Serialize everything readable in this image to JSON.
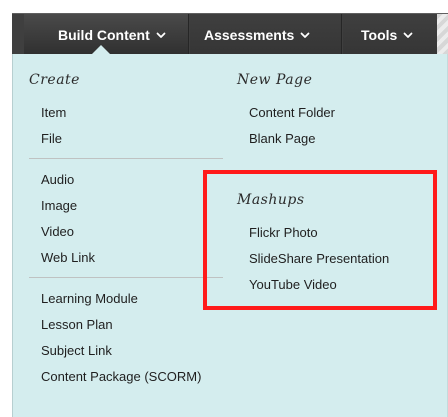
{
  "toolbar": {
    "tabs": [
      {
        "label": "Build Content",
        "has_dropdown": true
      },
      {
        "label": "Assessments",
        "has_dropdown": true
      },
      {
        "label": "Tools",
        "has_dropdown": true
      }
    ]
  },
  "dropdown": {
    "left_column": {
      "heading": "Create",
      "groups": [
        {
          "items": [
            "Item",
            "File"
          ]
        },
        {
          "items": [
            "Audio",
            "Image",
            "Video",
            "Web Link"
          ]
        },
        {
          "items": [
            "Learning Module",
            "Lesson Plan",
            "Subject Link",
            "Content Package (SCORM)"
          ]
        }
      ]
    },
    "right_column": {
      "new_page": {
        "heading": "New Page",
        "items": [
          "Content Folder",
          "Blank Page"
        ]
      },
      "mashups": {
        "heading": "Mashups",
        "items": [
          "Flickr Photo",
          "SlideShare Presentation",
          "YouTube Video"
        ]
      }
    }
  },
  "style": {
    "highlight_color": "#ff1a1a",
    "panel_bg": "#d4edee",
    "toolbar_bg": "#3f3f3f"
  }
}
